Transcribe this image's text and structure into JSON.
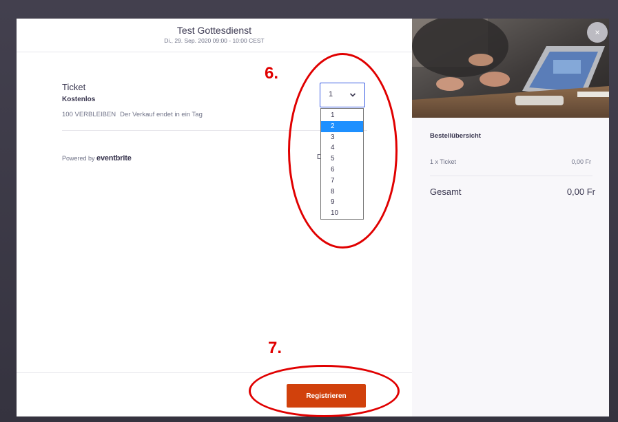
{
  "event": {
    "title": "Test Gottesdienst",
    "date": "Di., 29. Sep. 2020 09:00 - 10:00 CEST"
  },
  "ticket": {
    "name": "Ticket",
    "price": "Kostenlos",
    "remaining": "100 VERBLEIBEN",
    "sale_end": "Der Verkauf endet in ein Tag",
    "selected_quantity": "1",
    "quantity_options": [
      "1",
      "2",
      "3",
      "4",
      "5",
      "6",
      "7",
      "8",
      "9",
      "10"
    ],
    "highlighted_option": "2"
  },
  "footer": {
    "powered_by": "Powered by",
    "brand": "eventbrite",
    "stray_text": "D",
    "register_label": "Registrieren"
  },
  "summary": {
    "title": "Bestellübersicht",
    "line_label": "1 x Ticket",
    "line_price": "0,00 Fr",
    "total_label": "Gesamt",
    "total_price": "0,00 Fr"
  },
  "close_label": "×",
  "annotations": {
    "step6": "6.",
    "step7": "7."
  },
  "colors": {
    "accent_orange": "#d1410c",
    "focus_blue": "#3659e3",
    "highlight_blue": "#1e90ff",
    "annotation_red": "#e00000"
  },
  "icons": {
    "dropdown": "chevron-down-icon",
    "close": "close-icon"
  }
}
